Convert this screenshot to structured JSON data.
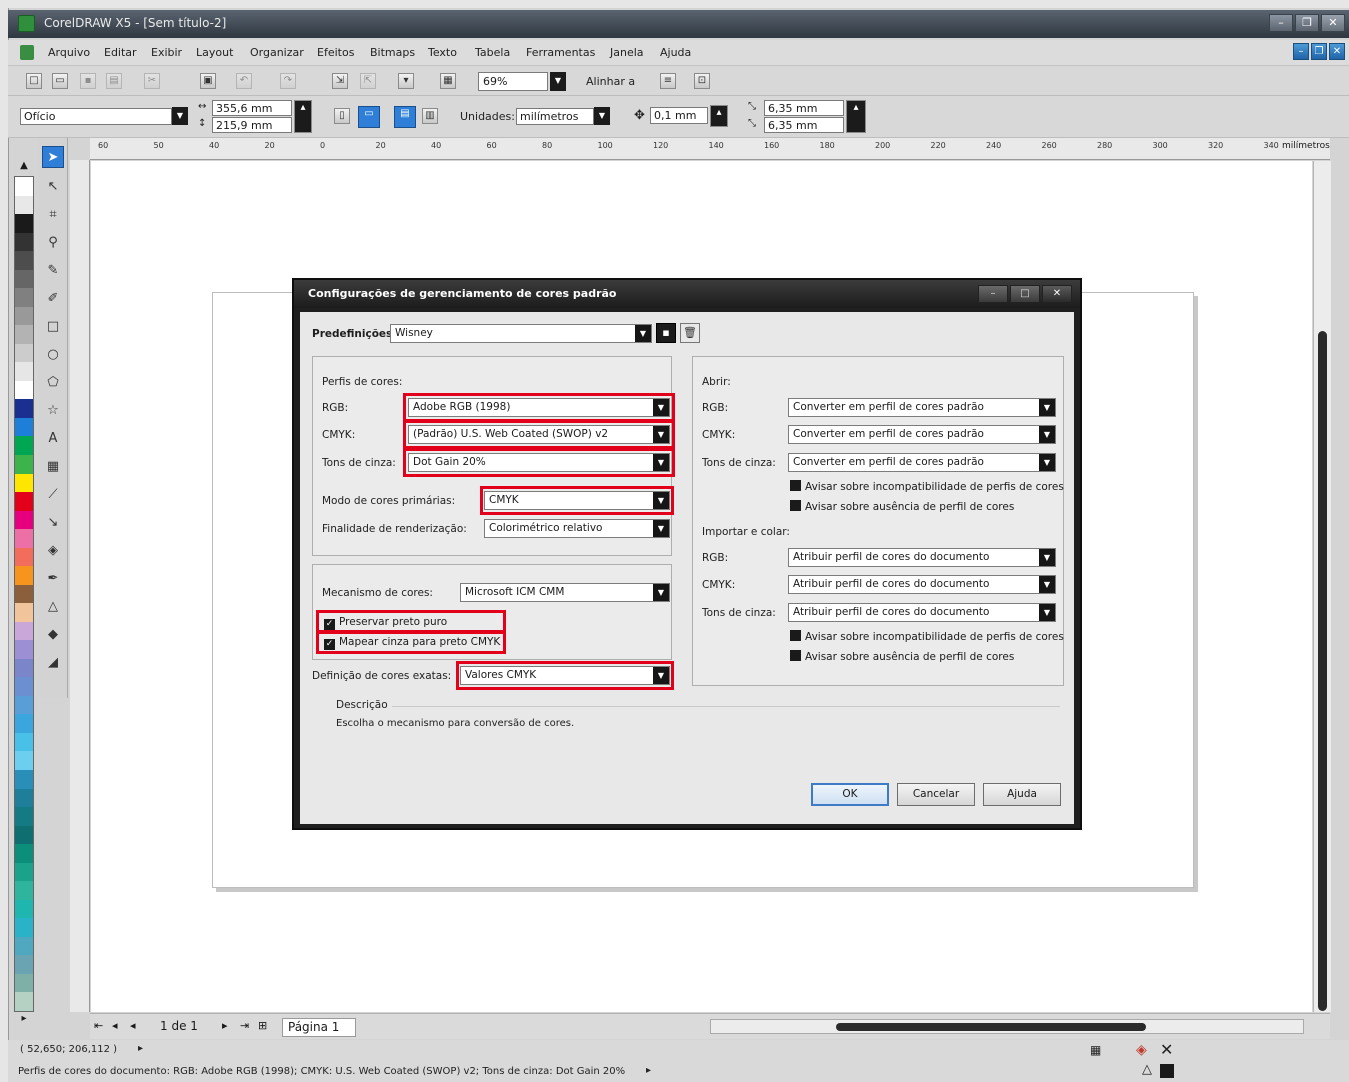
{
  "window": {
    "title": "CorelDRAW X5 - [Sem título-2]"
  },
  "menu": [
    "Arquivo",
    "Editar",
    "Exibir",
    "Layout",
    "Organizar",
    "Efeitos",
    "Bitmaps",
    "Texto",
    "Tabela",
    "Ferramentas",
    "Janela",
    "Ajuda"
  ],
  "toolbar": {
    "zoom": "69%",
    "align_label": "Alinhar a"
  },
  "property_bar": {
    "paper_size": "Ofício",
    "width": "355,6 mm",
    "height": "215,9 mm",
    "units_label": "Unidades:",
    "units_value": "milímetros",
    "nudge": "0,1 mm",
    "dup_x": "6,35 mm",
    "dup_y": "6,35 mm"
  },
  "ruler": {
    "h_ticks": [
      "60",
      "50",
      "40",
      "20",
      "0",
      "20",
      "40",
      "60",
      "80",
      "100",
      "120",
      "140",
      "160",
      "180",
      "200",
      "220",
      "240",
      "260",
      "280",
      "300",
      "320",
      "340"
    ],
    "unit": "milímetros"
  },
  "palette_colors": [
    "#ffffff",
    "#e8e8e8",
    "#1a1a1a",
    "#333333",
    "#4d4d4d",
    "#666666",
    "#808080",
    "#999999",
    "#b3b3b3",
    "#cccccc",
    "#e6e6e6",
    "#ffffff",
    "#1a2f8f",
    "#1e7fd8",
    "#00a651",
    "#3cb44b",
    "#ffe600",
    "#e3001b",
    "#e6007e",
    "#ec6fa6",
    "#f26d5b",
    "#f7941d",
    "#8b5e3c",
    "#f2c49b",
    "#c9a7d8",
    "#9d8fd3",
    "#7a86c9",
    "#6c8fd1",
    "#5a9ed8",
    "#3aa6dd",
    "#48c0e8",
    "#6ccff0",
    "#2a8fb8",
    "#1f7f9a",
    "#147a84",
    "#0f6e70",
    "#0b8f7a",
    "#1aa38a",
    "#2fb59d",
    "#1fb6b0",
    "#2ab3c8",
    "#4fa8bf",
    "#6aa4b2",
    "#7eb0a8",
    "#b5d1c4"
  ],
  "dialog": {
    "title": "Configurações de gerenciamento de cores padrão",
    "presets_label": "Predefinições:",
    "presets_value": "Wisney",
    "left": {
      "profiles_label": "Perfis de cores:",
      "rgb_label": "RGB:",
      "rgb_value": "Adobe RGB (1998)",
      "cmyk_label": "CMYK:",
      "cmyk_value": "(Padrão) U.S. Web Coated (SWOP) v2",
      "gray_label": "Tons de cinza:",
      "gray_value": "Dot Gain 20%",
      "primary_mode_label": "Modo de cores primárias:",
      "primary_mode_value": "CMYK",
      "rendering_label": "Finalidade de renderização:",
      "rendering_value": "Colorimétrico relativo",
      "engine_label": "Mecanismo de cores:",
      "engine_value": "Microsoft ICM CMM",
      "preserve_black": "Preservar preto puro",
      "map_gray": "Mapear cinza para preto CMYK",
      "spot_label": "Definição de cores exatas:",
      "spot_value": "Valores CMYK"
    },
    "right": {
      "open_label": "Abrir:",
      "rgb_label": "RGB:",
      "cmyk_label": "CMYK:",
      "gray_label": "Tons de cinza:",
      "open_rgb": "Converter em perfil de cores padrão",
      "open_cmyk": "Converter em perfil de cores padrão",
      "open_gray": "Converter em perfil de cores padrão",
      "warn_mismatch": "Avisar sobre incompatibilidade de perfis de cores",
      "warn_missing": "Avisar sobre ausência de perfil de cores",
      "import_label": "Importar e colar:",
      "import_rgb": "Atribuir perfil de cores do documento",
      "import_cmyk": "Atribuir perfil de cores do documento",
      "import_gray": "Atribuir perfil de cores do documento",
      "warn_mismatch2": "Avisar sobre incompatibilidade de perfis de cores",
      "warn_missing2": "Avisar sobre ausência de perfil de cores"
    },
    "description_title": "Descrição",
    "description_text": "Escolha o mecanismo para conversão de cores.",
    "ok": "OK",
    "cancel": "Cancelar",
    "help": "Ajuda"
  },
  "doc_nav": {
    "page_count": "1 de 1",
    "page_tab": "Página 1"
  },
  "status": {
    "coords": "( 52,650; 206,112 )",
    "profiles": "Perfis de cores do documento: RGB: Adobe RGB (1998); CMYK: U.S. Web Coated (SWOP) v2; Tons de cinza: Dot Gain 20%"
  }
}
